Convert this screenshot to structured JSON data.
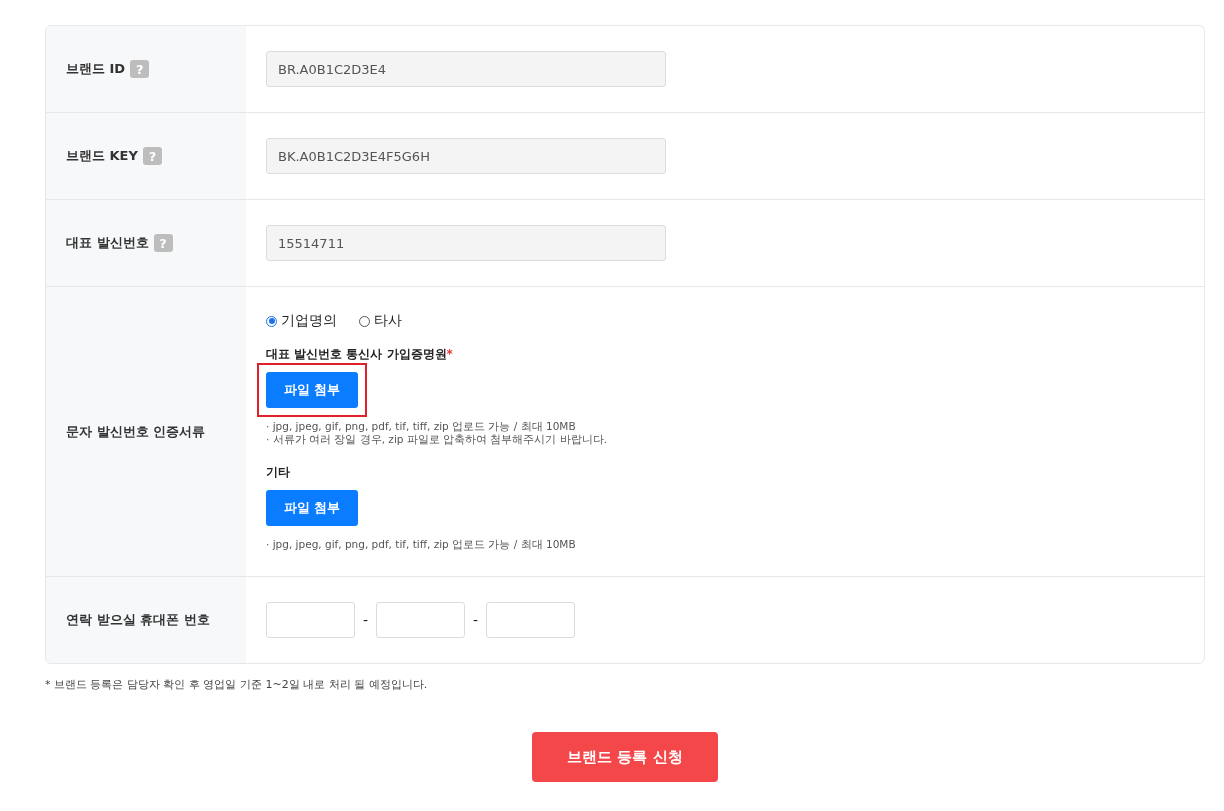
{
  "form_rows": [
    {
      "kind": "readonly",
      "label": "브랜드 ID",
      "help": "?",
      "value": "BR.A0B1C2D3E4"
    },
    {
      "kind": "readonly",
      "label": "브랜드 KEY",
      "help": "?",
      "value": "BK.A0B1C2D3E4F5G6H"
    },
    {
      "kind": "readonly",
      "label": "대표 발신번호",
      "help": "?",
      "value": "15514711"
    },
    {
      "kind": "documents",
      "label": "문자 발신번호 인증서류",
      "radios": [
        {
          "label": "기업명의",
          "selected": true
        },
        {
          "label": "타사",
          "selected": false
        }
      ],
      "sections": [
        {
          "title": "대표 발신번호 통신사 가입증명원",
          "required": "*",
          "button": "파일 첨부",
          "highlighted": true,
          "notes": [
            "· jpg, jpeg, gif, png, pdf, tif, tiff, zip 업로드 가능 / 최대 10MB",
            "· 서류가 여러 장일 경우, zip 파일로 압축하여 첨부해주시기 바랍니다."
          ]
        },
        {
          "title": "기타",
          "button": "파일 첨부",
          "highlighted": false,
          "notes": [
            "· jpg, jpeg, gif, png, pdf, tif, tiff, zip 업로드 가능 / 최대 10MB"
          ]
        }
      ]
    },
    {
      "kind": "phone",
      "label": "연락 받으실 휴대폰 번호",
      "separators": [
        "-",
        "-"
      ]
    }
  ],
  "footnote": "* 브랜드 등록은 담당자 확인 후 영업일 기준 1~2일 내로 처리 될 예정입니다.",
  "submit_button": "브랜드 등록 신청"
}
